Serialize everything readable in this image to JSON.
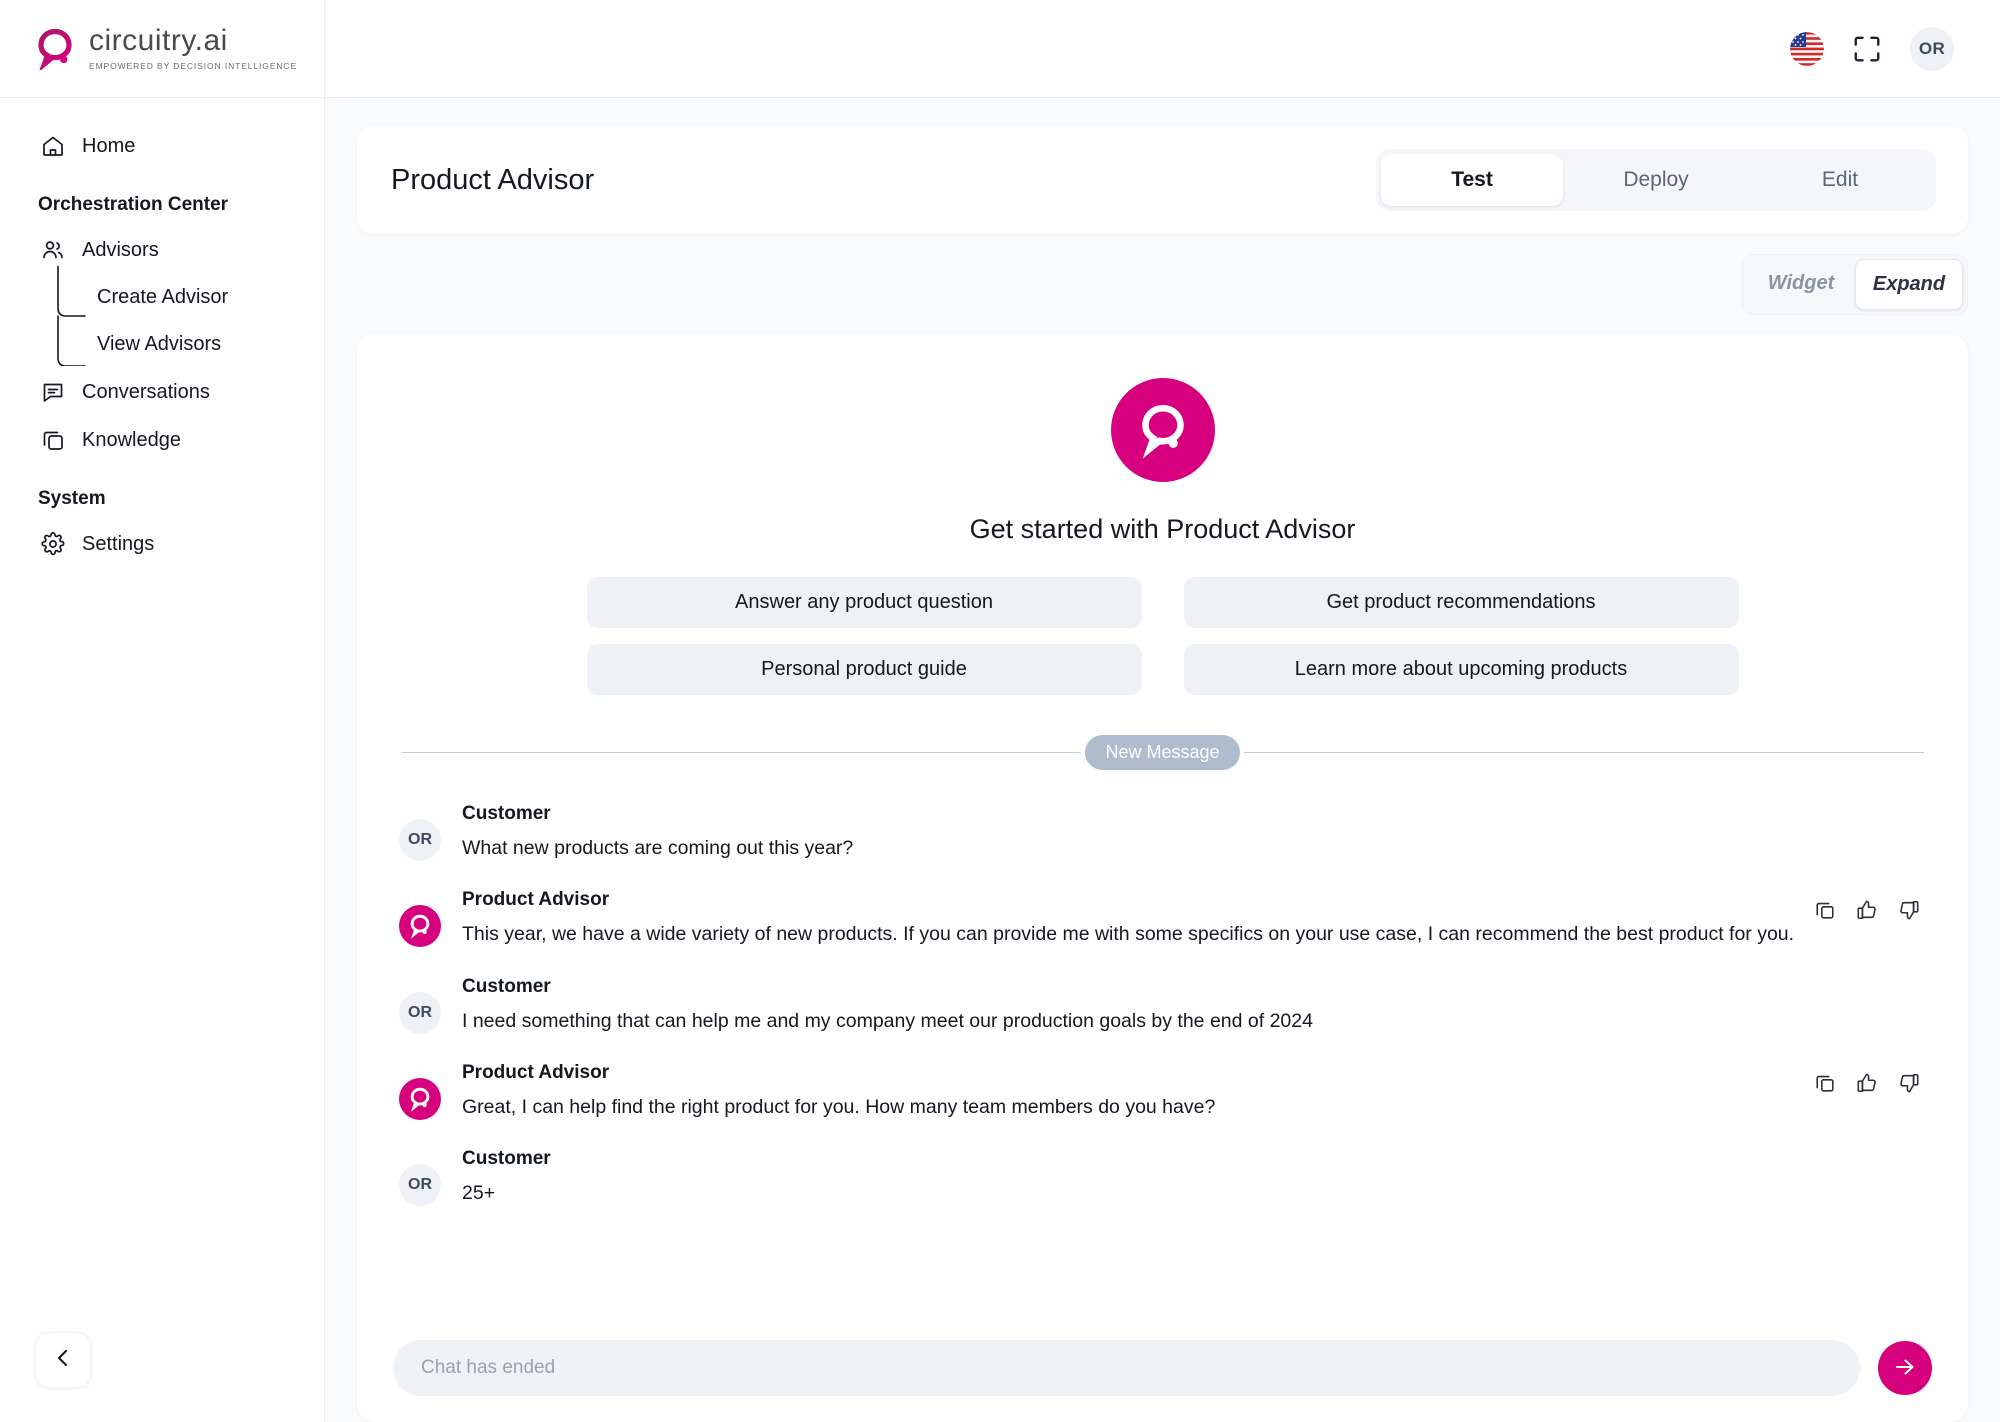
{
  "brand": {
    "name": "circuitry.ai",
    "tagline": "EMPOWERED BY DECISION INTELLIGENCE",
    "accent_color": "#D6007F",
    "logo_icon": "circuitry-lightbulb-icon"
  },
  "topbar": {
    "language_flag": "us-flag-icon",
    "fullscreen_icon": "fullscreen-icon",
    "avatar_initials": "OR"
  },
  "sidebar": {
    "home": {
      "label": "Home",
      "icon": "home-icon"
    },
    "sections": [
      {
        "title": "Orchestration Center",
        "items": [
          {
            "label": "Advisors",
            "icon": "users-icon"
          },
          {
            "label": "Conversations",
            "icon": "chat-bubble-icon"
          },
          {
            "label": "Knowledge",
            "icon": "copy-stack-icon"
          }
        ],
        "sub_items": [
          {
            "label": "Create Advisor"
          },
          {
            "label": "View Advisors"
          }
        ]
      },
      {
        "title": "System",
        "items": [
          {
            "label": "Settings",
            "icon": "gear-icon"
          }
        ]
      }
    ],
    "collapse_icon": "chevron-left-icon"
  },
  "header": {
    "title": "Product Advisor",
    "tabs": [
      {
        "label": "Test",
        "active": true
      },
      {
        "label": "Deploy",
        "active": false
      },
      {
        "label": "Edit",
        "active": false
      }
    ]
  },
  "view_mode": {
    "options": [
      {
        "label": "Widget",
        "active": false
      },
      {
        "label": "Expand",
        "active": true
      }
    ]
  },
  "welcome": {
    "title": "Get started with Product Advisor",
    "suggestions": [
      "Answer any product question",
      "Get product recommendations",
      "Personal product guide",
      "Learn more about upcoming products"
    ]
  },
  "divider": {
    "label": "New Message"
  },
  "conversation": {
    "messages": [
      {
        "author": "Customer",
        "role": "customer",
        "avatar": "OR",
        "text": "What new products are coming out this year?",
        "actions": false
      },
      {
        "author": "Product Advisor",
        "role": "advisor",
        "avatar": "logo",
        "text": "This year, we have a wide variety of new products. If you can provide me with some specifics on your use case, I can recommend the best product for you.",
        "actions": true
      },
      {
        "author": "Customer",
        "role": "customer",
        "avatar": "OR",
        "text": "I need something that can help me and my company meet our production goals by the end of 2024",
        "actions": false
      },
      {
        "author": "Product Advisor",
        "role": "advisor",
        "avatar": "logo",
        "text": "Great, I can help find the right product for you. How many team members do you have?",
        "actions": true
      },
      {
        "author": "Customer",
        "role": "customer",
        "avatar": "OR",
        "text": "25+",
        "actions": false
      }
    ],
    "action_icons": [
      "copy-icon",
      "thumbs-up-icon",
      "thumbs-down-icon"
    ]
  },
  "composer": {
    "placeholder": "Chat has ended",
    "value": "",
    "send_icon": "send-icon"
  }
}
